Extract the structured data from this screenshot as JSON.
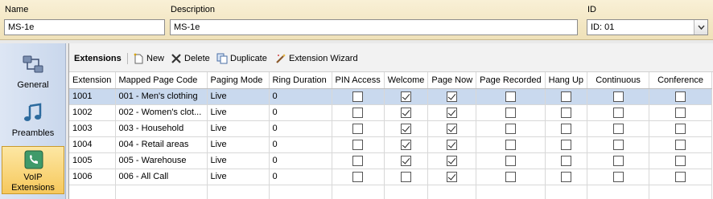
{
  "header": {
    "name_label": "Name",
    "name_value": "MS-1e",
    "description_label": "Description",
    "description_value": "MS-1e",
    "id_label": "ID",
    "id_value": "ID: 01"
  },
  "leftnav": {
    "items": [
      {
        "label": "General",
        "icon": "network-icon",
        "active": false
      },
      {
        "label": "Preambles",
        "icon": "music-note-icon",
        "active": false
      },
      {
        "label_line1": "VoIP",
        "label_line2": "Extensions",
        "icon": "phone-icon",
        "active": true
      }
    ]
  },
  "toolbar": {
    "title": "Extensions",
    "new_label": "New",
    "delete_label": "Delete",
    "duplicate_label": "Duplicate",
    "wizard_label": "Extension Wizard"
  },
  "table": {
    "columns": [
      "Extension",
      "Mapped Page Code",
      "Paging Mode",
      "Ring Duration",
      "PIN Access",
      "Welcome",
      "Page Now",
      "Page Recorded",
      "Hang Up",
      "Continuous",
      "Conference"
    ],
    "rows": [
      {
        "extension": "1001",
        "code": "001 - Men's clothing",
        "mode": "Live",
        "ring": "0",
        "pin": false,
        "welcome": true,
        "page_now": true,
        "recorded": false,
        "hangup": false,
        "continuous": false,
        "conference": false
      },
      {
        "extension": "1002",
        "code": "002 - Women's clot...",
        "mode": "Live",
        "ring": "0",
        "pin": false,
        "welcome": true,
        "page_now": true,
        "recorded": false,
        "hangup": false,
        "continuous": false,
        "conference": false
      },
      {
        "extension": "1003",
        "code": "003 - Household",
        "mode": "Live",
        "ring": "0",
        "pin": false,
        "welcome": true,
        "page_now": true,
        "recorded": false,
        "hangup": false,
        "continuous": false,
        "conference": false
      },
      {
        "extension": "1004",
        "code": "004 - Retail areas",
        "mode": "Live",
        "ring": "0",
        "pin": false,
        "welcome": true,
        "page_now": true,
        "recorded": false,
        "hangup": false,
        "continuous": false,
        "conference": false
      },
      {
        "extension": "1005",
        "code": "005 - Warehouse",
        "mode": "Live",
        "ring": "0",
        "pin": false,
        "welcome": true,
        "page_now": true,
        "recorded": false,
        "hangup": false,
        "continuous": false,
        "conference": false
      },
      {
        "extension": "1006",
        "code": "006 - All Call",
        "mode": "Live",
        "ring": "0",
        "pin": false,
        "welcome": false,
        "page_now": true,
        "recorded": false,
        "hangup": false,
        "continuous": false,
        "conference": false
      }
    ],
    "selected_row": 0
  },
  "colors": {
    "header_bg": "#f3e6c2",
    "nav_active": "#f6c85c",
    "row_selected": "#c9d9ee"
  }
}
